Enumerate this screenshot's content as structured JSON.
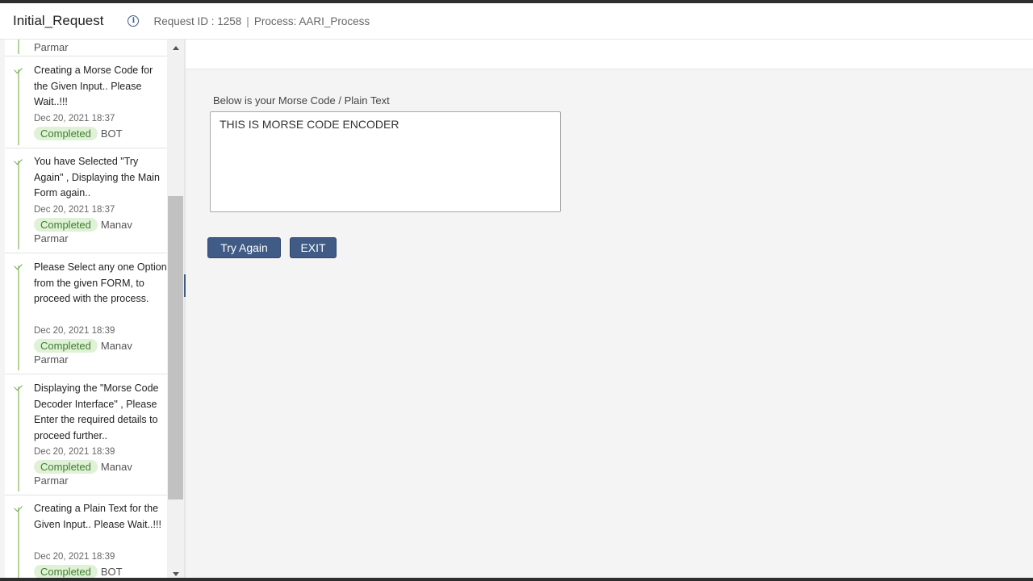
{
  "header": {
    "title": "Initial_Request",
    "info_icon": "info-icon",
    "request_id": "Request ID : 1258",
    "separator": "|",
    "process": "Process: AARI_Process"
  },
  "sidebar": {
    "partial_top": "Parmar",
    "items": [
      {
        "message": "Creating a Morse Code for the Given Input.. Please Wait..!!!",
        "date": "Dec 20, 2021 18:37",
        "status": "Completed",
        "actor": "BOT"
      },
      {
        "message": "You have Selected \"Try Again\" , Displaying the Main Form again..",
        "date": "Dec 20, 2021 18:37",
        "status": "Completed",
        "actor": "Manav Parmar"
      },
      {
        "message": "Please Select any one Option from the given FORM, to proceed with the process.",
        "date": "Dec 20, 2021 18:39",
        "status": "Completed",
        "actor": "Manav Parmar"
      },
      {
        "message": "Displaying the \"Morse Code Decoder Interface\" , Please Enter the required details to proceed further..",
        "date": "Dec 20, 2021 18:39",
        "status": "Completed",
        "actor": "Manav Parmar"
      },
      {
        "message": "Creating a Plain Text for the Given Input.. Please Wait..!!!",
        "date": "Dec 20, 2021 18:39",
        "status": "Completed",
        "actor": "BOT"
      }
    ]
  },
  "main": {
    "field_label": "Below is your Morse Code / Plain Text",
    "field_value": "THIS IS MORSE CODE ENCODER",
    "try_again_label": "Try Again",
    "exit_label": "EXIT"
  },
  "colors": {
    "accent": "#3f5b86",
    "completed_bg": "#dff1d6",
    "completed_text": "#3f7f2e"
  }
}
